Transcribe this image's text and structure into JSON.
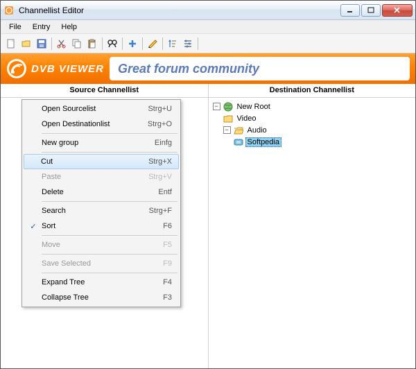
{
  "window": {
    "title": "Channellist Editor"
  },
  "menubar": {
    "items": [
      "File",
      "Entry",
      "Help"
    ]
  },
  "toolbar": {
    "buttons": [
      {
        "name": "new-icon"
      },
      {
        "name": "open-icon"
      },
      {
        "name": "save-icon"
      },
      {
        "sep": true
      },
      {
        "name": "cut-icon"
      },
      {
        "name": "copy-icon"
      },
      {
        "name": "paste-icon"
      },
      {
        "sep": true
      },
      {
        "name": "search-icon"
      },
      {
        "sep": true
      },
      {
        "name": "add-icon"
      },
      {
        "sep": true
      },
      {
        "name": "edit-icon"
      },
      {
        "sep": true
      },
      {
        "name": "sort-icon"
      },
      {
        "name": "options-icon"
      },
      {
        "sep": true
      }
    ]
  },
  "banner": {
    "brand": "DVB VIEWER",
    "slogan": "Great forum community"
  },
  "panels": {
    "left_title": "Source Channellist",
    "right_title": "Destination Channellist"
  },
  "context_menu": {
    "items": [
      {
        "label": "Open Sourcelist",
        "shortcut": "Strg+U"
      },
      {
        "label": "Open Destinationlist",
        "shortcut": "Strg+O"
      },
      {
        "sep": true
      },
      {
        "label": "New group",
        "shortcut": "Einfg"
      },
      {
        "sep": true
      },
      {
        "label": "Cut",
        "shortcut": "Strg+X",
        "hover": true
      },
      {
        "label": "Paste",
        "shortcut": "Strg+V",
        "disabled": true
      },
      {
        "label": "Delete",
        "shortcut": "Entf"
      },
      {
        "sep": true
      },
      {
        "label": "Search",
        "shortcut": "Strg+F"
      },
      {
        "label": "Sort",
        "shortcut": "F6",
        "checked": true
      },
      {
        "sep": true
      },
      {
        "label": "Move",
        "shortcut": "F5",
        "disabled": true
      },
      {
        "sep": true
      },
      {
        "label": "Save Selected",
        "shortcut": "F9",
        "disabled": true
      },
      {
        "sep": true
      },
      {
        "label": "Expand Tree",
        "shortcut": "F4"
      },
      {
        "label": "Collapse Tree",
        "shortcut": "F3"
      }
    ]
  },
  "tree": {
    "root": "New Root",
    "video": "Video",
    "audio": "Audio",
    "channel": "Softpedia"
  }
}
